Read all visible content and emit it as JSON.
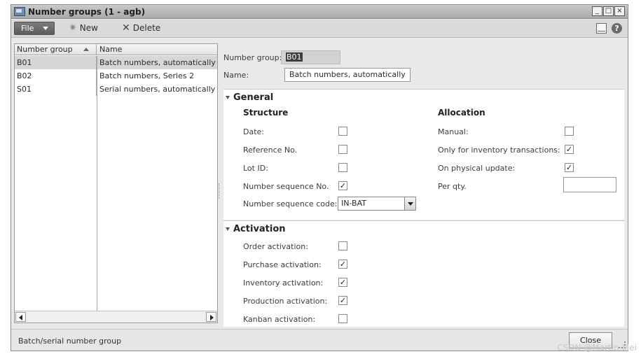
{
  "window": {
    "title": "Number groups (1 - agb)",
    "buttons": [
      "_",
      "□",
      "×"
    ]
  },
  "toolbar": {
    "file_label": "File",
    "new_label": "New",
    "delete_label": "Delete"
  },
  "grid": {
    "columns": [
      "Number group",
      "Name"
    ],
    "rows": [
      {
        "group": "B01",
        "name": "Batch numbers, automatically",
        "selected": true
      },
      {
        "group": "B02",
        "name": "Batch numbers, Series 2",
        "selected": false
      },
      {
        "group": "S01",
        "name": "Serial numbers, automatically",
        "selected": false
      }
    ]
  },
  "header_fields": {
    "number_group_label": "Number group:",
    "number_group_value": "B01",
    "name_label": "Name:",
    "name_value": "Batch numbers, automatically"
  },
  "general": {
    "title": "General",
    "structure": {
      "heading": "Structure",
      "date_label": "Date:",
      "date_checked": false,
      "reference_label": "Reference No.",
      "reference_checked": false,
      "lot_label": "Lot ID:",
      "lot_checked": false,
      "numseq_label": "Number sequence No.",
      "numseq_checked": true,
      "numseq_code_label": "Number sequence code:",
      "numseq_code_value": "IN-BAT"
    },
    "allocation": {
      "heading": "Allocation",
      "manual_label": "Manual:",
      "manual_checked": false,
      "inventory_only_label": "Only for inventory transactions:",
      "inventory_only_checked": true,
      "physical_label": "On physical update:",
      "physical_checked": true,
      "perqty_label": "Per qty.",
      "perqty_value": ""
    }
  },
  "activation": {
    "title": "Activation",
    "order_label": "Order activation:",
    "order_checked": false,
    "purchase_label": "Purchase activation:",
    "purchase_checked": true,
    "inventory_label": "Inventory activation:",
    "inventory_checked": true,
    "production_label": "Production activation:",
    "production_checked": true,
    "kanban_label": "Kanban activation:",
    "kanban_checked": false
  },
  "status": {
    "text": "Batch/serial number group",
    "close_label": "Close"
  },
  "watermark": "CSDN @Martin-Mei",
  "colors": {
    "title_bar": "#b5b5b5",
    "selected_row": "#d6d6d6",
    "panel_bg": "#ffffff"
  }
}
